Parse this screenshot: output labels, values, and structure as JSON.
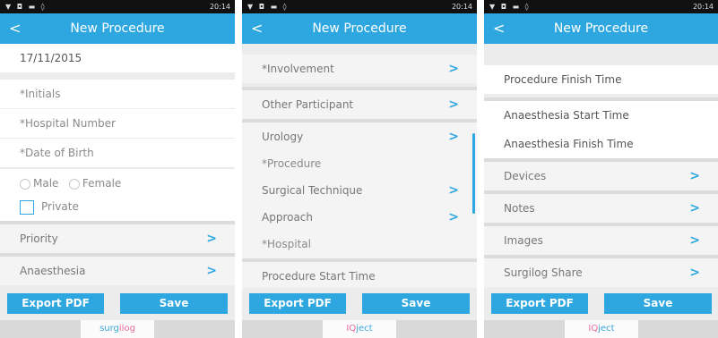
{
  "status": {
    "signal": "▼ ◘ ▬ ◊",
    "time": "20:14",
    "battery": "■ ◔ 📶 "
  },
  "appbar": {
    "back_icon": "<",
    "title": "New Procedure"
  },
  "screen1": {
    "date": "17/11/2015",
    "initials": "*Initials",
    "hospital_number": "*Hospital Number",
    "dob": "*Date of Birth",
    "male": "Male",
    "female": "Female",
    "private": "Private",
    "priority": "Priority",
    "anaesthesia": "Anaesthesia",
    "footer_logo_a": "surg",
    "footer_logo_b": "ilog"
  },
  "screen2": {
    "involvement": "*Involvement",
    "other_participant": "Other Participant",
    "urology": "Urology",
    "procedure": "*Procedure",
    "surgical_technique": "Surgical Technique",
    "approach": "Approach",
    "hospital": "*Hospital",
    "procedure_start": "Procedure Start Time",
    "footer_logo_a": "IQ",
    "footer_logo_b": "ject"
  },
  "screen3": {
    "procedure_finish": "Procedure Finish Time",
    "anaesthesia_start": "Anaesthesia Start Time",
    "anaesthesia_finish": "Anaesthesia Finish Time",
    "devices": "Devices",
    "notes": "Notes",
    "images": "Images",
    "surgilog_share": "Surgilog Share",
    "footer_logo_a": "IQ",
    "footer_logo_b": "ject"
  },
  "buttons": {
    "export_pdf": "Export PDF",
    "save": "Save"
  },
  "chevron": ">",
  "colors": {
    "accent": "#2ea7e0",
    "status_bar": "#111111",
    "background": "#ececec"
  }
}
